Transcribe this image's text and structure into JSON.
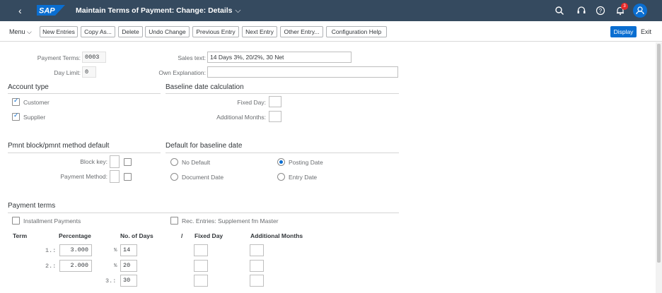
{
  "shell": {
    "back_glyph": "‹",
    "logo_text": "SAP",
    "title": "Maintain Terms of Payment: Change: Details",
    "notification_count": "3"
  },
  "toolbar": {
    "menu_label": "Menu ⌵",
    "buttons": [
      "New Entries",
      "Copy As...",
      "Delete",
      "Undo Change",
      "Previous Entry",
      "Next Entry",
      "Other Entry...",
      "Configuration Help"
    ],
    "display_label": "Display",
    "exit_label": "Exit"
  },
  "header_fields": {
    "payment_terms_label": "Payment Terms:",
    "payment_terms_value": "0003",
    "day_limit_label": "Day Limit:",
    "day_limit_value": "0",
    "sales_text_label": "Sales text:",
    "sales_text_value": "14 Days 3%, 20/2%, 30 Net",
    "own_explanation_label": "Own Explanation:",
    "own_explanation_value": ""
  },
  "account_type": {
    "title": "Account type",
    "customer_label": "Customer",
    "customer_checked": true,
    "supplier_label": "Supplier",
    "supplier_checked": true
  },
  "baseline_calc": {
    "title": "Baseline date calculation",
    "fixed_day_label": "Fixed Day:",
    "fixed_day_value": "",
    "additional_months_label": "Additional Months:",
    "additional_months_value": ""
  },
  "pmnt_block": {
    "title": "Pmnt block/pmnt method default",
    "block_key_label": "Block key:",
    "payment_method_label": "Payment Method:"
  },
  "default_baseline": {
    "title": "Default for baseline date",
    "options": [
      "No Default",
      "Document Date",
      "Posting Date",
      "Entry Date"
    ],
    "selected": "Posting Date"
  },
  "payment_terms": {
    "title": "Payment terms",
    "installment_label": "Installment Payments",
    "rec_entries_label": "Rec. Entries: Supplement fm Master",
    "columns": {
      "term": "Term",
      "percentage": "Percentage",
      "no_of_days": "No. of Days",
      "slash": "/",
      "fixed_day": "Fixed Day",
      "additional_months": "Additional Months"
    },
    "rows": [
      {
        "term": "1.:",
        "percentage": "3.000",
        "pct_sign": "%",
        "days": "14"
      },
      {
        "term": "2.:",
        "percentage": "2.000",
        "pct_sign": "%",
        "days": "20"
      },
      {
        "term": "3.:",
        "percentage": "",
        "pct_sign": "",
        "days": "30"
      }
    ]
  },
  "colors": {
    "shell_bg": "#354a5f",
    "accent": "#0a6ed1",
    "badge": "#e52929"
  }
}
